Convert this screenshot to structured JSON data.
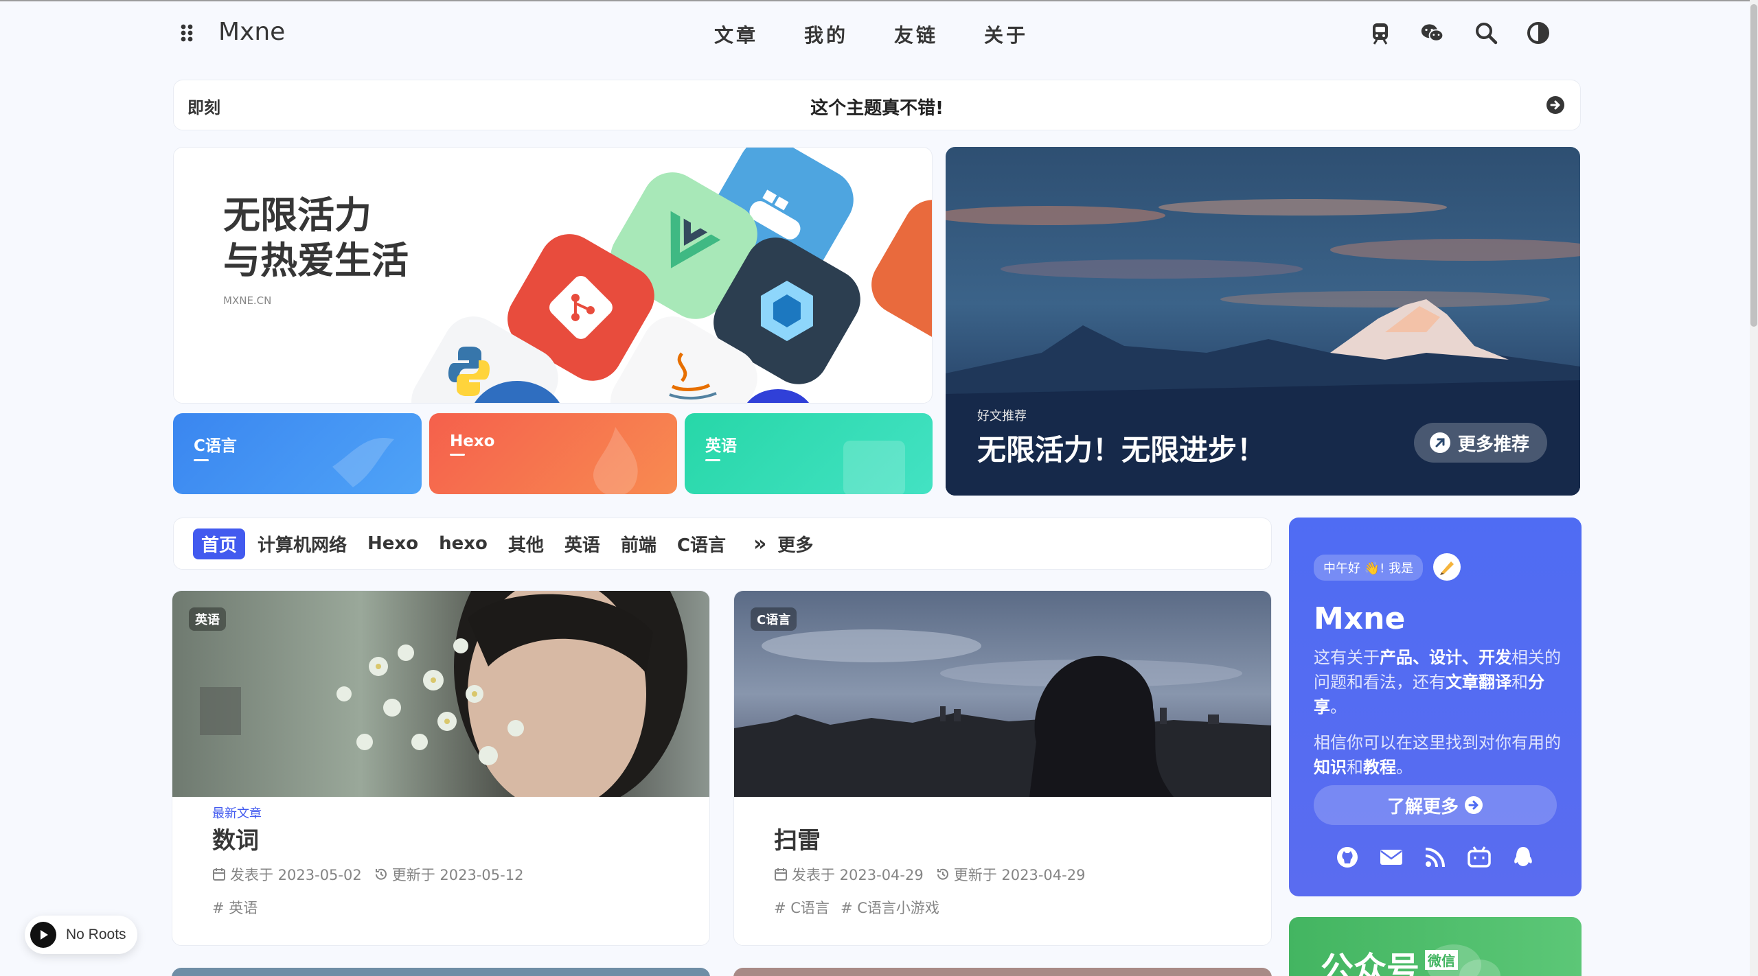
{
  "nav": {
    "brand": "Mxne",
    "menu": [
      "文章",
      "我的",
      "友链",
      "关于"
    ]
  },
  "notice": {
    "label": "即刻",
    "message": "这个主题真不错!"
  },
  "hero": {
    "title_line1": "无限活力",
    "title_line2": "与热爱生活",
    "site": "MXNE.CN",
    "categories": [
      "C语言",
      "Hexo",
      "英语"
    ],
    "featured_small": "好文推荐",
    "featured_title": "无限活力！无限进步！",
    "more_label": "更多推荐"
  },
  "tabs": {
    "items": [
      "首页",
      "计算机网络",
      "Hexo",
      "hexo",
      "其他",
      "英语",
      "前端",
      "C语言"
    ],
    "more_label": "更多"
  },
  "articles": [
    {
      "badge": "英语",
      "new_tag": "最新文章",
      "title": "数词",
      "published": "发表于 2023-05-02",
      "updated": "更新于 2023-05-12",
      "tags": [
        "# 英语"
      ]
    },
    {
      "badge": "C语言",
      "new_tag": "",
      "title": "扫雷",
      "published": "发表于 2023-04-29",
      "updated": "更新于 2023-04-29",
      "tags": [
        "# C语言",
        "# C语言小游戏"
      ]
    }
  ],
  "author": {
    "hello": "中午好 👋! 我是",
    "name": "Mxne",
    "intro_1a": "这有关于",
    "intro_1b": "产品、设计、开发",
    "intro_1c": "相关的问题和看法，还有",
    "intro_1d": "文章翻译",
    "intro_1e": "和",
    "intro_1f": "分享",
    "intro_1g": "。",
    "intro_2a": "相信你可以在这里找到对你有用的",
    "intro_2b": "知识",
    "intro_2c": "和",
    "intro_2d": "教程",
    "intro_2e": "。",
    "learn_more": "了解更多"
  },
  "wechat": {
    "title": "公众号",
    "badge": "微信"
  },
  "player": {
    "label": "No Roots"
  },
  "colors": {
    "accent": "#425aef",
    "cat_blue": "#3e8df3",
    "cat_orange": "#f7734e",
    "cat_green": "#2fd8b3",
    "wechat": "#43b561"
  }
}
